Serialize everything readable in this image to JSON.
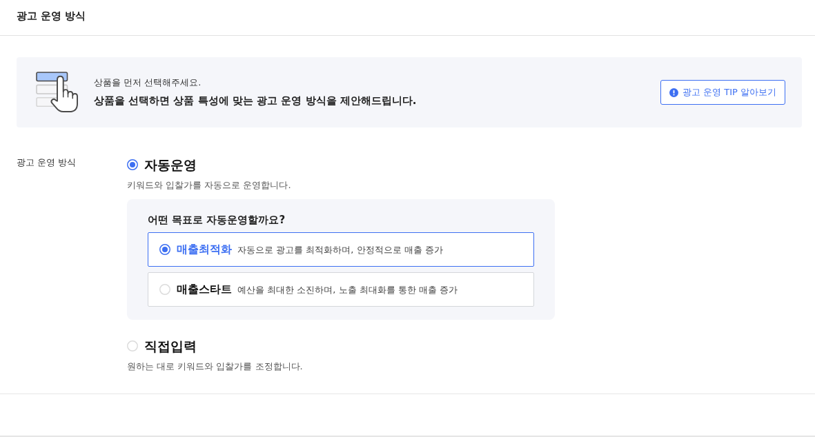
{
  "header": {
    "title": "광고 운영 방식"
  },
  "notice": {
    "message": "상품을 먼저 선택해주세요.",
    "description": "상품을 선택하면 상품 특성에 맞는 광고 운영 방식을 제안해드립니다.",
    "tip_button": "광고 운영 TIP 알아보기"
  },
  "form": {
    "label": "광고 운영 방식",
    "options": [
      {
        "label": "자동운영",
        "description": "키워드와 입찰가를 자동으로 운영합니다.",
        "selected": true,
        "goal_panel": {
          "question": "어떤 목표로 자동운영할까요?",
          "goals": [
            {
              "name": "매출최적화",
              "description": "자동으로 광고를 최적화하며, 안정적으로 매출 증가",
              "selected": true
            },
            {
              "name": "매출스타트",
              "description": "예산을 최대한 소진하며, 노출 최대화를 통한 매출 증가",
              "selected": false
            }
          ]
        }
      },
      {
        "label": "직접입력",
        "description": "원하는 대로 키워드와 입찰가를 조정합니다.",
        "selected": false
      }
    ]
  }
}
